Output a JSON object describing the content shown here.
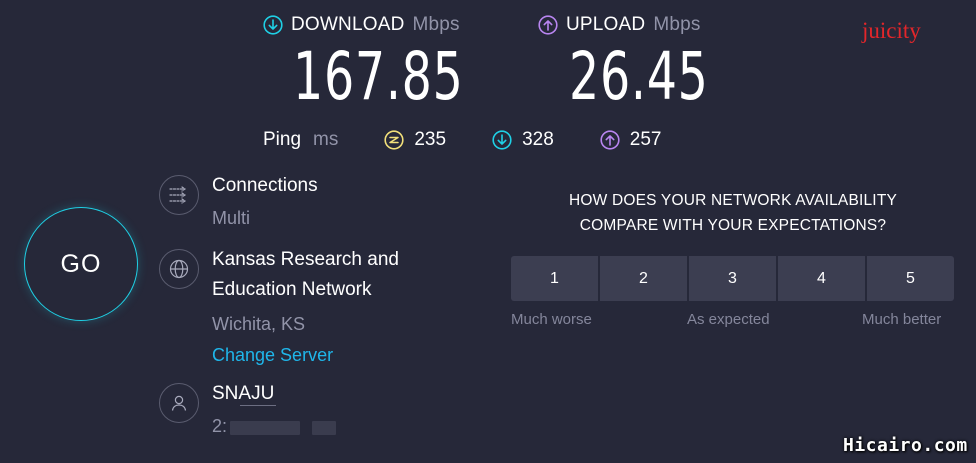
{
  "download": {
    "label": "DOWNLOAD",
    "unit": "Mbps",
    "value": "167.85"
  },
  "upload": {
    "label": "UPLOAD",
    "unit": "Mbps",
    "value": "26.45"
  },
  "ping": {
    "label": "Ping",
    "unit": "ms",
    "idle": "235",
    "download": "328",
    "upload": "257"
  },
  "go_button": {
    "label": "GO"
  },
  "connections": {
    "title": "Connections",
    "value": "Multi"
  },
  "server": {
    "name_line1": "Kansas Research and",
    "name_line2": "Education Network",
    "location": "Wichita, KS",
    "change_label": "Change Server"
  },
  "user": {
    "name": "SNAJU",
    "ip_visible": "2:"
  },
  "survey": {
    "question_line1": "HOW DOES YOUR NETWORK AVAILABILITY",
    "question_line2": "COMPARE WITH YOUR EXPECTATIONS?",
    "options": [
      "1",
      "2",
      "3",
      "4",
      "5"
    ],
    "low_label": "Much worse",
    "mid_label": "As expected",
    "high_label": "Much better"
  },
  "overlay": {
    "brand": "juicity",
    "watermark": "Hicairo.com"
  },
  "colors": {
    "background": "#262839",
    "download": "#1fd0e5",
    "upload": "#b885f0",
    "ping": "#f2e07a",
    "link": "#1fb6ea"
  }
}
